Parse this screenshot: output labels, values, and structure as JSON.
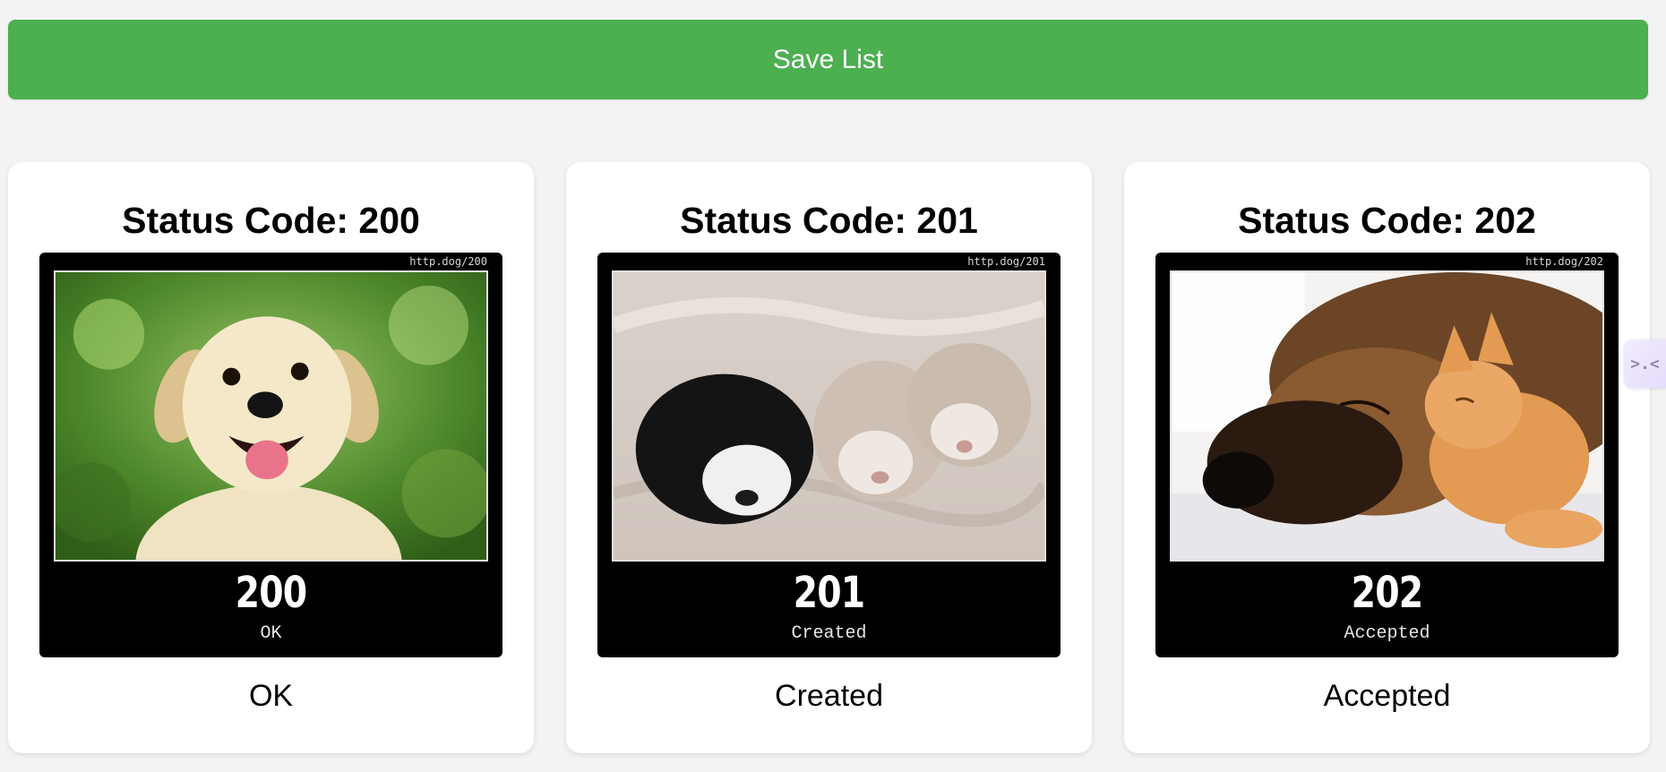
{
  "toolbar": {
    "save_label": "Save List",
    "accent": "#4caf50"
  },
  "cards": [
    {
      "title": "Status Code: 200",
      "url": "http.dog/200",
      "code": "200",
      "code_text": "OK",
      "description": "OK",
      "photo": "labrador-puppy-photo"
    },
    {
      "title": "Status Code: 201",
      "url": "http.dog/201",
      "code": "201",
      "code_text": "Created",
      "description": "Created",
      "photo": "husky-puppies-photo"
    },
    {
      "title": "Status Code: 202",
      "url": "http.dog/202",
      "code": "202",
      "code_text": "Accepted",
      "description": "Accepted",
      "photo": "dog-and-cat-photo"
    }
  ],
  "side_tab": {
    "icon": "extension-face-icon",
    "glyph": ">.<"
  }
}
